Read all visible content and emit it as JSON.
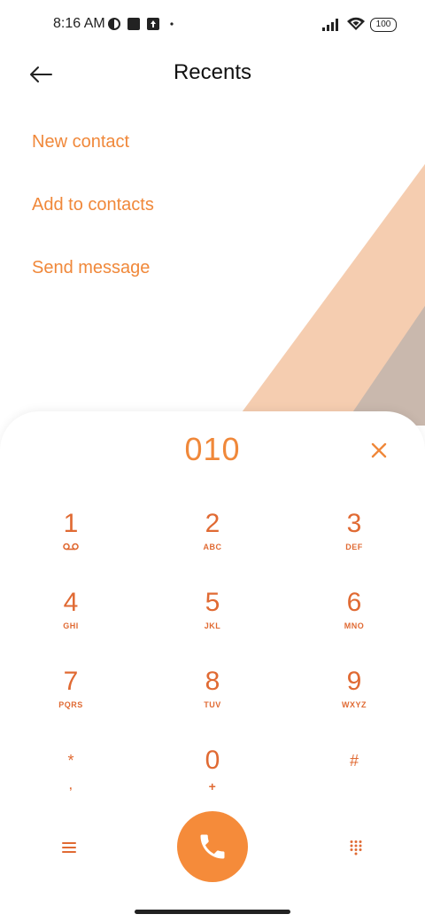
{
  "status_bar": {
    "time": "8:16 AM",
    "battery": "100",
    "icons": [
      "app-icon",
      "square-icon",
      "upload-icon",
      "dot-icon",
      "signal-icon",
      "wifi-icon",
      "battery-icon"
    ]
  },
  "header": {
    "title": "Recents",
    "back_icon": "arrow-left-icon"
  },
  "actions": [
    {
      "label": "New contact"
    },
    {
      "label": "Add to contacts"
    },
    {
      "label": "Send message"
    }
  ],
  "dialer": {
    "number": "010",
    "clear_icon": "close-icon",
    "keys": [
      {
        "digit": "1",
        "letters": "voicemail-icon"
      },
      {
        "digit": "2",
        "letters": "ABC"
      },
      {
        "digit": "3",
        "letters": "DEF"
      },
      {
        "digit": "4",
        "letters": "GHI"
      },
      {
        "digit": "5",
        "letters": "JKL"
      },
      {
        "digit": "6",
        "letters": "MNO"
      },
      {
        "digit": "7",
        "letters": "PQRS"
      },
      {
        "digit": "8",
        "letters": "TUV"
      },
      {
        "digit": "9",
        "letters": "WXYZ"
      },
      {
        "digit": "*",
        "letters": ","
      },
      {
        "digit": "0",
        "letters": "+"
      },
      {
        "digit": "#",
        "letters": ""
      }
    ]
  },
  "bottom": {
    "menu_icon": "menu-icon",
    "call_icon": "phone-icon",
    "keypad_icon": "dialpad-icon"
  },
  "colors": {
    "accent": "#f0883a",
    "key_text": "#e06a33",
    "call_button": "#f58b3a",
    "deco_peach": "#f5cdb0",
    "deco_taupe": "#c9b8ad"
  }
}
